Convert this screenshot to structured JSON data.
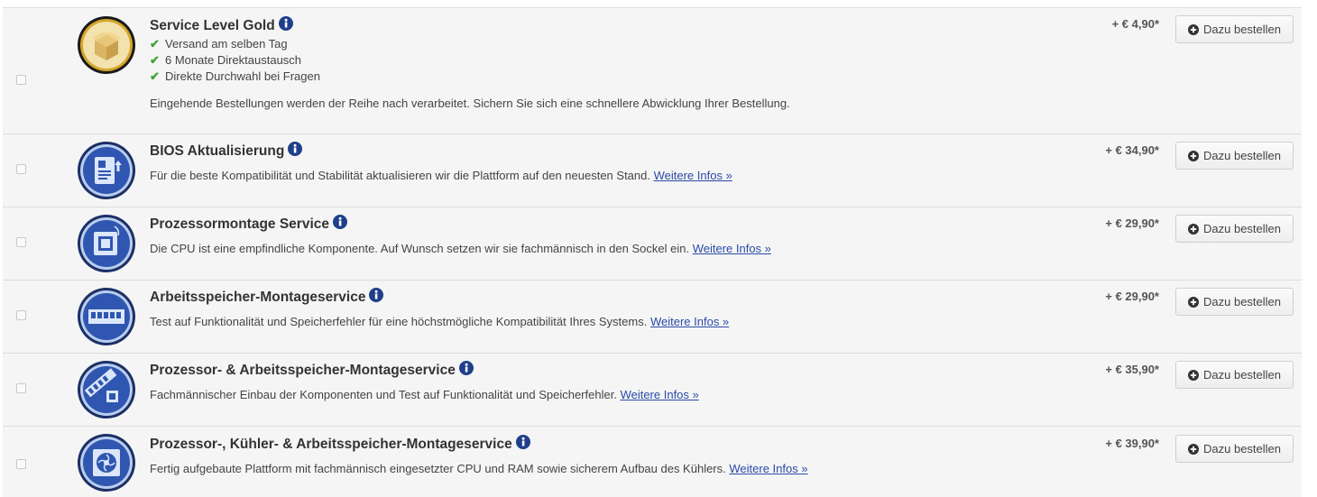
{
  "services": [
    {
      "title": "Service Level Gold",
      "icon": "gold-box-icon",
      "features": [
        "Versand am selben Tag",
        "6 Monate Direktaustausch",
        "Direkte Durchwahl bei Fragen"
      ],
      "description": "Eingehende Bestellungen werden der Reihe nach verarbeitet. Sichern Sie sich eine schnellere Abwicklung Ihrer Bestellung.",
      "link": "",
      "price": "+ € 4,90*",
      "button": "Dazu bestellen"
    },
    {
      "title": "BIOS Aktualisierung",
      "icon": "bios-chip-icon",
      "description": "Für die beste Kompatibilität und Stabilität aktualisieren wir die Plattform auf den neuesten Stand.",
      "link": "Weitere Infos »",
      "price": "+ € 34,90*",
      "button": "Dazu bestellen"
    },
    {
      "title": "Prozessormontage Service",
      "icon": "cpu-icon",
      "description": "Die CPU ist eine empfindliche Komponente. Auf Wunsch setzen wir sie fachmännisch in den Sockel ein.",
      "link": "Weitere Infos »",
      "price": "+ € 29,90*",
      "button": "Dazu bestellen"
    },
    {
      "title": "Arbeitsspeicher-Montageservice",
      "icon": "ram-module-icon",
      "description": "Test auf Funktionalität und Speicherfehler für eine höchstmögliche Kompatibilität Ihres Systems.",
      "link": "Weitere Infos »",
      "price": "+ € 29,90*",
      "button": "Dazu bestellen"
    },
    {
      "title": "Prozessor- & Arbeitsspeicher-Montageservice",
      "icon": "cpu-ram-icon",
      "description": "Fachmännischer Einbau der Komponenten und Test auf Funktionalität und Speicherfehler.",
      "link": "Weitere Infos »",
      "price": "+ € 35,90*",
      "button": "Dazu bestellen"
    },
    {
      "title": "Prozessor-, Kühler- & Arbeitsspeicher-Montageservice",
      "icon": "cooler-fan-icon",
      "description": "Fertig aufgebaute Plattform mit fachmännisch eingesetzter CPU und RAM sowie sicherem Aufbau des Kühlers.",
      "link": "Weitere Infos »",
      "price": "+ € 39,90*",
      "button": "Dazu bestellen"
    }
  ],
  "colors": {
    "icon_blue": "#1f3f8a",
    "check_green": "#3ba539",
    "link_blue": "#2b4aa8",
    "row_bg": "#f5f5f5"
  }
}
